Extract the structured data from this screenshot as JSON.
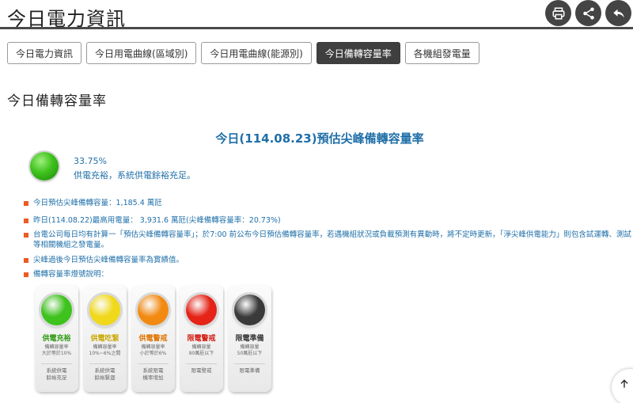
{
  "header": {
    "title": "今日電力資訊",
    "print_icon": "printer-icon",
    "share_icon": "share-icon",
    "back_icon": "back-arrow-icon"
  },
  "tabs": [
    {
      "label": "今日電力資訊",
      "active": false
    },
    {
      "label": "今日用電曲線(區域別)",
      "active": false
    },
    {
      "label": "今日用電曲線(能源別)",
      "active": false
    },
    {
      "label": "今日備轉容量率",
      "active": true
    },
    {
      "label": "各機組發電量",
      "active": false
    }
  ],
  "section_title": "今日備轉容量率",
  "report": {
    "title": "今日(114.08.23)預估尖峰備轉容量率",
    "reserve_rate": "33.75%",
    "status_text": "供電充裕，系統供電餘裕充足。",
    "status_color": "#3ec21d"
  },
  "bullets": [
    "今日預估尖峰備轉容量：1,185.4 萬瓩",
    "昨日(114.08.22)最高用電量： 3,931.6 萬瓩(尖峰備轉容量率：20.73%)",
    "台電公司每日均有計算一「預估尖峰備轉容量率」；於7:00 前公布今日預估備轉容量率，若遇機組狀況或負載預測有異動時，將不定時更新，「淨尖峰供電能力」則包含試運轉、測試等相關機組之發電量。",
    "尖峰過後今日預估尖峰備轉容量率為實績值。",
    "備轉容量率燈號說明："
  ],
  "legend": [
    {
      "label": "供電充裕",
      "color": "#3ec21d",
      "label_color": "#2f9a12",
      "desc": "備轉容量率\n大於等於10%",
      "note": "系統供電\n餘裕充足"
    },
    {
      "label": "供電吃緊",
      "color": "#f0d81a",
      "label_color": "#c9a800",
      "desc": "備轉容量率\n10%~6%之間",
      "note": "系統供電\n餘裕緊澀"
    },
    {
      "label": "供電警戒",
      "color": "#f28a12",
      "label_color": "#e07400",
      "desc": "備轉容量率\n小於等於6%",
      "note": "系統限電\n機率增加"
    },
    {
      "label": "限電警戒",
      "color": "#e52317",
      "label_color": "#d41a10",
      "desc": "備轉容量\n90萬瓩以下",
      "note": "限電警戒"
    },
    {
      "label": "限電準備",
      "color": "#3a3a3a",
      "label_color": "#333333",
      "desc": "備轉容量\n50萬瓩以下",
      "note": "限電準備"
    }
  ],
  "scroll_top_icon": "arrow-up-icon"
}
